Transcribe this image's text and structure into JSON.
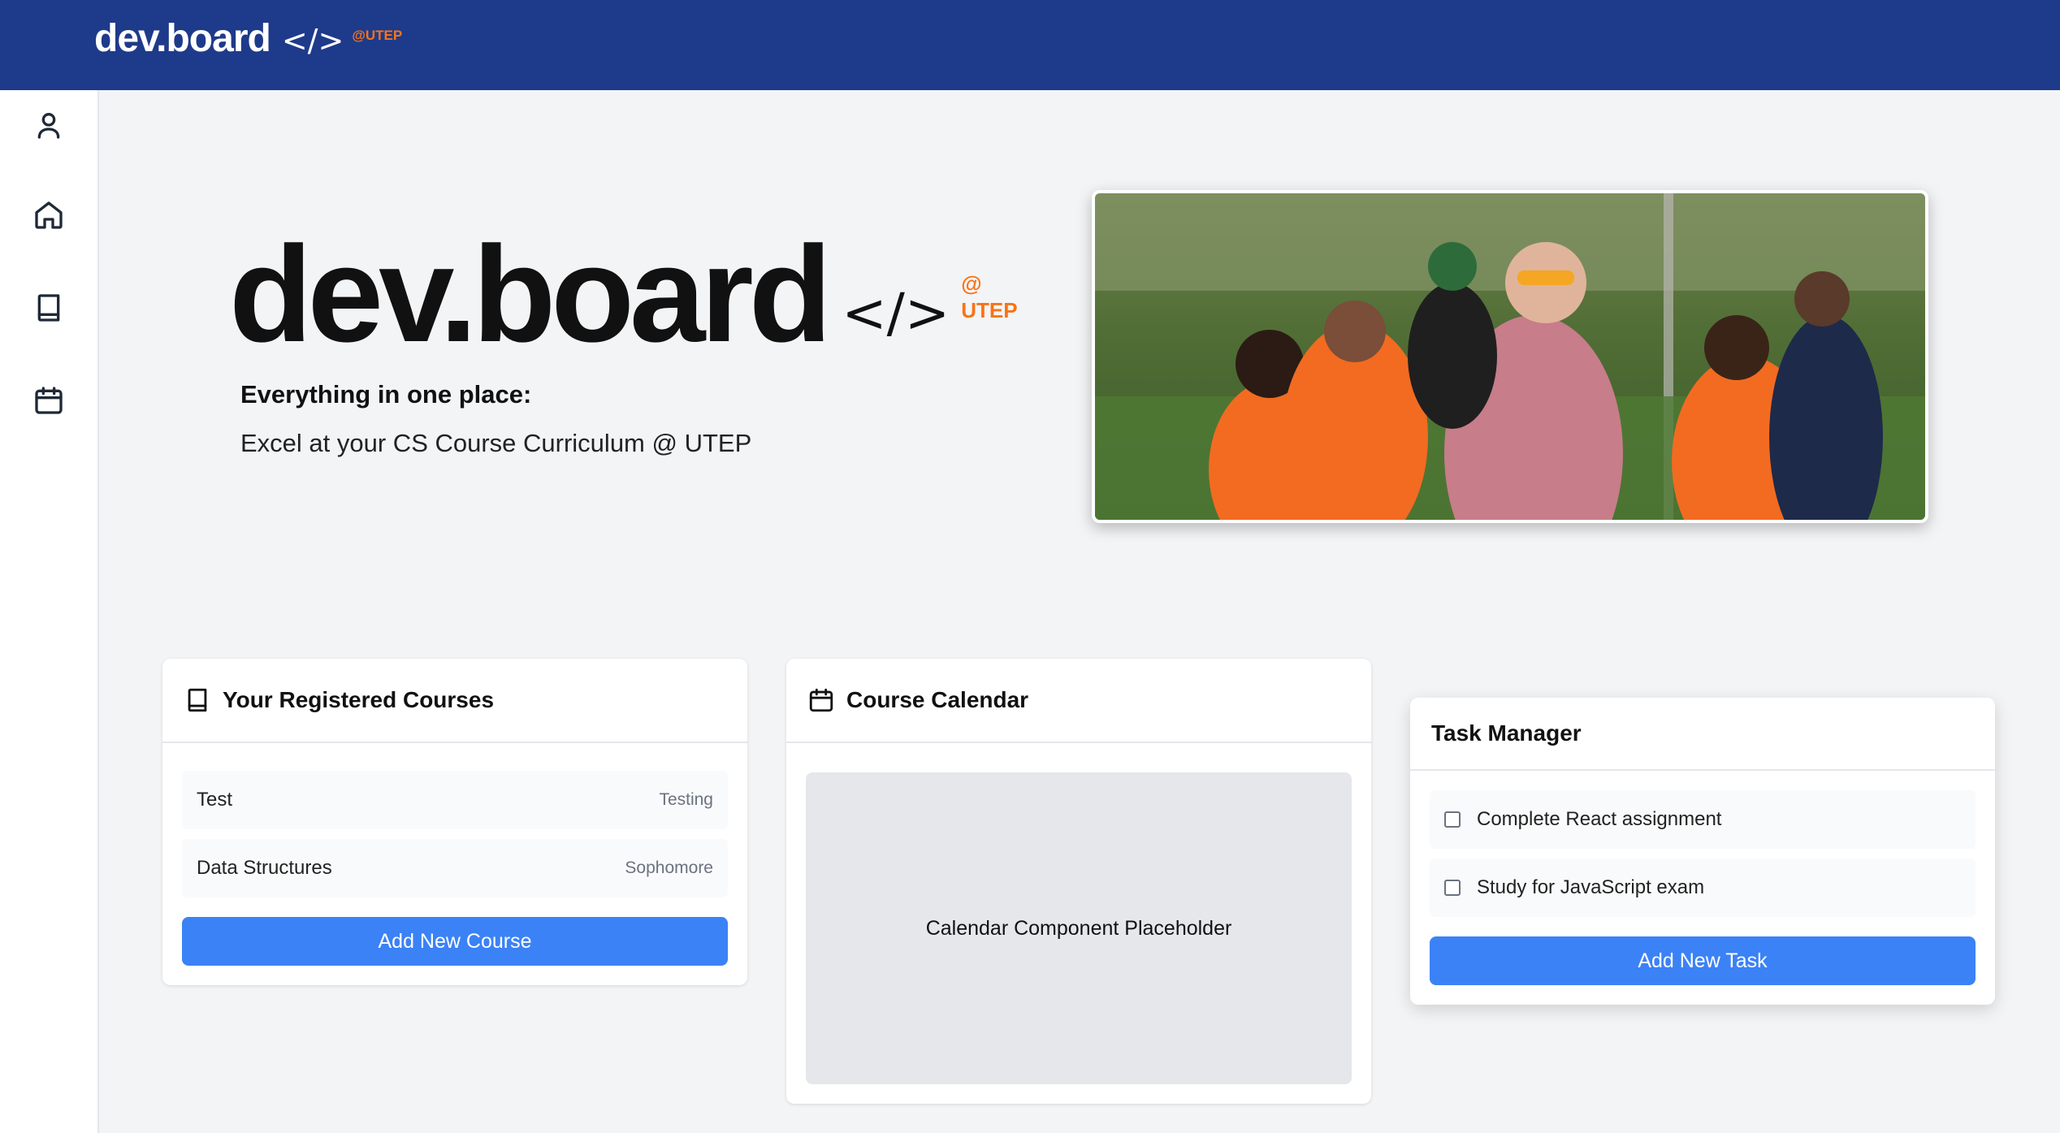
{
  "header": {
    "brand_name": "dev.board",
    "brand_code": "</>",
    "brand_utep": "@UTEP"
  },
  "sidebar": {
    "items": [
      {
        "icon": "user-icon"
      },
      {
        "icon": "home-icon"
      },
      {
        "icon": "book-icon"
      },
      {
        "icon": "calendar-icon"
      }
    ]
  },
  "hero": {
    "title": "dev.board",
    "code": "</>",
    "at": "@",
    "utep": "UTEP",
    "tagline": "Everything in one place:",
    "subtitle": "Excel at your CS Course Curriculum @ UTEP"
  },
  "courses_card": {
    "title": "Your Registered Courses",
    "courses": [
      {
        "name": "Test",
        "level": "Testing"
      },
      {
        "name": "Data Structures",
        "level": "Sophomore"
      }
    ],
    "add_button": "Add New Course"
  },
  "calendar_card": {
    "title": "Course Calendar",
    "placeholder": "Calendar Component Placeholder"
  },
  "tasks_card": {
    "title": "Task Manager",
    "tasks": [
      {
        "label": "Complete React assignment",
        "checked": false
      },
      {
        "label": "Study for JavaScript exam",
        "checked": false
      }
    ],
    "add_button": "Add New Task"
  },
  "colors": {
    "topbar": "#1e3a8a",
    "accent": "#3b82f6",
    "utep_orange": "#f97316"
  }
}
